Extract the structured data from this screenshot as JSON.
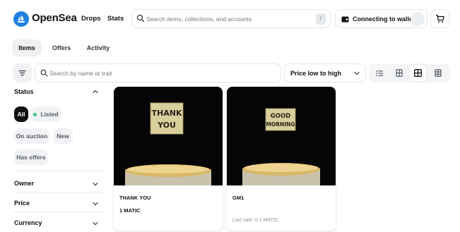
{
  "header": {
    "brand": "OpenSea",
    "nav": {
      "drops": "Drops",
      "stats": "Stats"
    },
    "search": {
      "placeholder": "Search items, collections, and accounts",
      "shortcut": "/"
    },
    "wallet": {
      "label": "Connecting to wallet"
    }
  },
  "tabs": [
    {
      "label": "Items",
      "active": true
    },
    {
      "label": "Offers",
      "active": false
    },
    {
      "label": "Activity",
      "active": false
    }
  ],
  "toolbar": {
    "search_placeholder": "Search by name or trait",
    "sort_value": "Price low to high",
    "views": [
      {
        "icon": "list-view-icon",
        "active": false
      },
      {
        "icon": "grid-large-view-icon",
        "active": false
      },
      {
        "icon": "grid-view-icon",
        "active": true
      },
      {
        "icon": "grid-small-view-icon",
        "active": false
      }
    ]
  },
  "sidebar": {
    "status": {
      "title": "Status",
      "options": [
        {
          "label": "All",
          "active": true
        },
        {
          "label": "Listed",
          "active": false
        },
        {
          "label": "On auction",
          "active": false
        },
        {
          "label": "New",
          "active": false
        },
        {
          "label": "Has offers",
          "active": false
        }
      ]
    },
    "sections": [
      {
        "label": "Owner"
      },
      {
        "label": "Price"
      },
      {
        "label": "Currency"
      }
    ]
  },
  "items": [
    {
      "name": "THANK YOU",
      "price": "1 MATIC",
      "last_sale": "",
      "sign_text": [
        "THANK",
        "YOU"
      ]
    },
    {
      "name": "GM1",
      "price": "",
      "last_sale": "Last sale: 0.1 MATIC",
      "sign_text": [
        "GOOD",
        "MORNING"
      ]
    }
  ],
  "colors": {
    "brand": "#2081e2",
    "text": "#121212",
    "muted": "#707a83",
    "listed_dot": "#34c77b",
    "card_image_bg": "#050505",
    "sign_paper": "#d8cf9c"
  }
}
